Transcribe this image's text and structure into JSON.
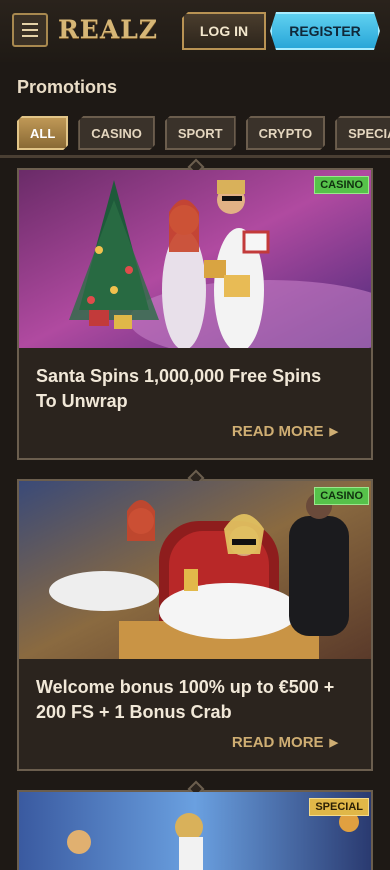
{
  "header": {
    "logo": "REALZ",
    "login_label": "LOG IN",
    "register_label": "REGISTER",
    "menu_icon": "hamburger-icon"
  },
  "page": {
    "title": "Promotions"
  },
  "filters": [
    "ALL",
    "CASINO",
    "SPORT",
    "CRYPTO",
    "SPECIALS"
  ],
  "active_filter": "ALL",
  "promotions": [
    {
      "badge": "CASINO",
      "title": "Santa Spins 1,000,000 Free Spins To Unwrap",
      "cta": "READ MORE"
    },
    {
      "badge": "CASINO",
      "title": "Welcome bonus 100% up to €500 + 200 FS + 1 Bonus Crab",
      "cta": "READ MORE"
    },
    {
      "badge": "SPECIAL"
    }
  ],
  "colors": {
    "background": "#1e1915",
    "gold": "#cfae73",
    "register_blue": "#28a6d8",
    "casino_badge": "#56c24a",
    "special_badge": "#e0b748"
  }
}
